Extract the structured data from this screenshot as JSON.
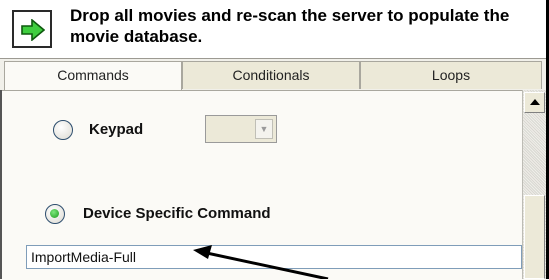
{
  "header": {
    "description": "Drop all movies and re-scan the server to populate the movie database.",
    "icon": "green-right-arrow-icon"
  },
  "tabs": [
    {
      "label": "Commands",
      "active": true
    },
    {
      "label": "Conditionals",
      "active": false
    },
    {
      "label": "Loops",
      "active": false
    }
  ],
  "options": {
    "keypad_label": "Keypad",
    "keypad_selected": false,
    "keypad_value": "",
    "device_label": "Device Specific Command",
    "device_selected": true
  },
  "command_input": {
    "value": "ImportMedia-Full"
  },
  "colors": {
    "accent_green": "#1c9a1c",
    "tab_bg": "#ece9d8",
    "panel_bg": "#fbfaf6"
  }
}
